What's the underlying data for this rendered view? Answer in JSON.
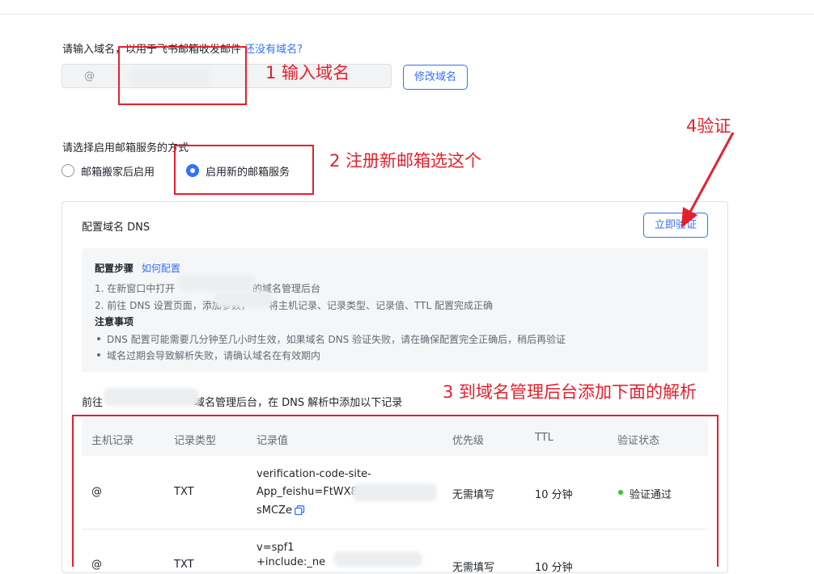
{
  "domain_section": {
    "prompt": "请输入域名，以用于飞书邮箱收发邮件",
    "no_domain_link": "还没有域名?",
    "at_prefix": "@",
    "edit_button": "修改域名"
  },
  "service_section": {
    "prompt": "请选择启用邮箱服务的方式",
    "options": [
      {
        "label": "邮箱搬家后启用",
        "selected": false
      },
      {
        "label": "启用新的邮箱服务",
        "selected": true
      }
    ]
  },
  "dns_panel": {
    "title": "配置域名 DNS",
    "verify_button": "立即验证",
    "steps_title": "配置步骤",
    "how_link": "如何配置",
    "step1_a": "1. 在新窗口中打开",
    "step1_b": "的域名管理后台",
    "step2_a": "2. 前往 DNS 设置页面，添加参数，",
    "step2_b": "将主机记录、记录类型、记录值、TTL 配置完成正确",
    "notes_title": "注意事项",
    "note1": "DNS 配置可能需要几分钟至几小时生效，如果域名 DNS 验证失败，请在确保配置完全正确后，稍后再验证",
    "note2": "域名过期会导致解析失败，请确认域名在有效期内",
    "goto_a": "前往",
    "goto_b": "域名管理后台，在 DNS 解析中添加以下记录"
  },
  "table": {
    "headers": [
      "主机记录",
      "记录类型",
      "记录值",
      "优先级",
      "TTL",
      "验证状态"
    ],
    "rows": [
      {
        "host": "@",
        "type": "TXT",
        "value_lines": [
          "verification-code-site-",
          "App_feishu=FtWX8",
          "sMCZe"
        ],
        "priority": "无需填写",
        "ttl": "10 分钟",
        "status": "验证通过"
      },
      {
        "host": "@",
        "type": "TXT",
        "value_lines": [
          "v=spf1",
          "+include:_ne"
        ],
        "priority": "无需填写",
        "ttl": "10 分钟"
      }
    ]
  },
  "annotations": {
    "a1": "1 输入域名",
    "a2": "2 注册新邮箱选这个",
    "a3": "3 到域名管理后台添加下面的解析",
    "a4": "4验证"
  },
  "colors": {
    "accent": "#3370ff",
    "annotation_red": "#e5202e",
    "success_green": "#34c724"
  },
  "icons": [
    "copy-icon",
    "arrow-annotation"
  ]
}
